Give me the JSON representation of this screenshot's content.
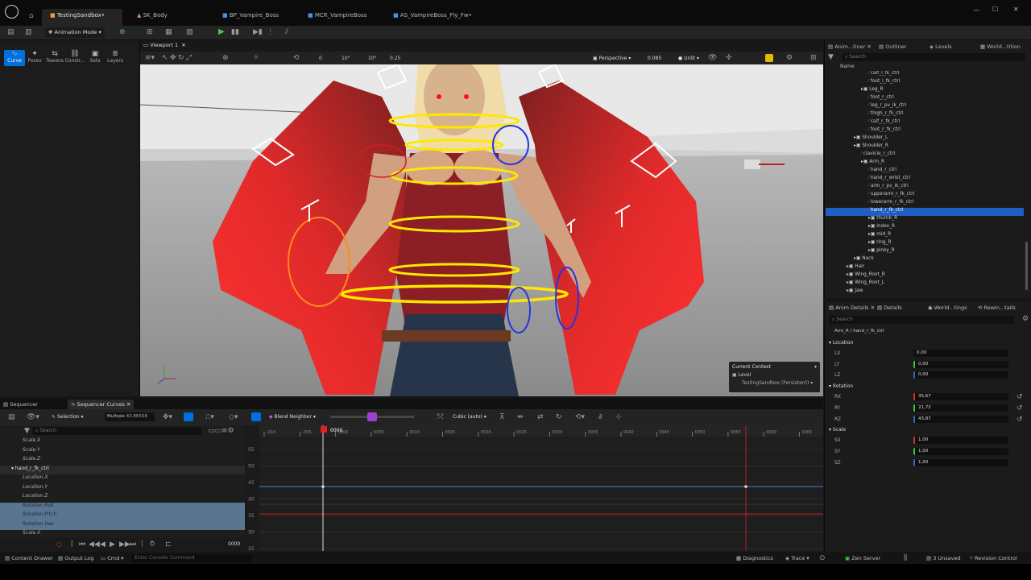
{
  "tabs": [
    "TestingSandbox•",
    "SK_Body",
    "BP_Vampire_Boss",
    "MCR_VampireBoss",
    "AS_VampireBoss_Fly_Fw•"
  ],
  "toolbar": {
    "mode_label": "Animation Mode"
  },
  "modes": [
    "Curve",
    "Poses",
    "Tweens",
    "Constr...",
    "Sets",
    "Layers"
  ],
  "viewport": {
    "tab": "Viewport 1",
    "view": "Perspective",
    "fov": "0.085",
    "unit": "Unlit",
    "snap_rot": "10°",
    "snap_rot2": "10°",
    "scale": "0.25",
    "grid": "0"
  },
  "context": {
    "title": "Current Context",
    "level_label": "Level",
    "level_value": "TestingSandbox (Persistent)"
  },
  "right_tabs": [
    "Anim...tiner",
    "Outliner",
    "Levels",
    "World...tition"
  ],
  "outliner": {
    "search_placeholder": "Search",
    "column": "Name",
    "rows": [
      {
        "l": "calf_l_fk_ctrl",
        "d": 5,
        "k": "c"
      },
      {
        "l": "foot_l_fk_ctrl",
        "d": 5,
        "k": "c"
      },
      {
        "l": "Leg_R",
        "d": 4,
        "k": "g"
      },
      {
        "l": "foot_r_ctrl",
        "d": 5,
        "k": "c"
      },
      {
        "l": "leg_r_pv_ik_ctrl",
        "d": 5,
        "k": "c"
      },
      {
        "l": "thigh_r_fk_ctrl",
        "d": 5,
        "k": "c"
      },
      {
        "l": "calf_r_fk_ctrl",
        "d": 5,
        "k": "c"
      },
      {
        "l": "foot_r_fk_ctrl",
        "d": 5,
        "k": "c"
      },
      {
        "l": "Shoulder_L",
        "d": 3,
        "k": "g"
      },
      {
        "l": "Shoulder_R",
        "d": 3,
        "k": "g"
      },
      {
        "l": "clavicle_r_ctrl",
        "d": 4,
        "k": "c"
      },
      {
        "l": "Arm_R",
        "d": 4,
        "k": "g"
      },
      {
        "l": "hand_r_ctrl",
        "d": 5,
        "k": "c"
      },
      {
        "l": "hand_r_wrist_ctrl",
        "d": 5,
        "k": "c"
      },
      {
        "l": "arm_r_pv_ik_ctrl",
        "d": 5,
        "k": "c"
      },
      {
        "l": "upperarm_r_fk_ctrl",
        "d": 5,
        "k": "c"
      },
      {
        "l": "lowerarm_r_fk_ctrl",
        "d": 5,
        "k": "c"
      },
      {
        "l": "hand_r_fk_ctrl",
        "d": 5,
        "k": "c",
        "sel": true
      },
      {
        "l": "thumb_R",
        "d": 5,
        "k": "g"
      },
      {
        "l": "index_R",
        "d": 5,
        "k": "g"
      },
      {
        "l": "mid_R",
        "d": 5,
        "k": "g"
      },
      {
        "l": "ring_R",
        "d": 5,
        "k": "g"
      },
      {
        "l": "pinky_R",
        "d": 5,
        "k": "g"
      },
      {
        "l": "Neck",
        "d": 3,
        "k": "g"
      },
      {
        "l": "Hair",
        "d": 2,
        "k": "g"
      },
      {
        "l": "Wing_Root_R",
        "d": 2,
        "k": "g"
      },
      {
        "l": "Wing_Root_L",
        "d": 2,
        "k": "g"
      },
      {
        "l": "Jaw",
        "d": 2,
        "k": "g"
      }
    ]
  },
  "details_tabs": [
    "Anim Details",
    "Details",
    "World...tings",
    "Rewin...tails"
  ],
  "details": {
    "search_placeholder": "Search",
    "path": "Arm_R / hand_r_fk_ctrl",
    "location": {
      "title": "Location",
      "LX": "0,00",
      "LY": "0,00",
      "LZ": "0,00"
    },
    "rotation": {
      "title": "Rotation",
      "RX": "35,67",
      "RY": "21,72",
      "RZ": "43,87"
    },
    "scale": {
      "title": "Scale",
      "SX": "1,00",
      "SY": "1,00",
      "SZ": "1,00"
    }
  },
  "sequencer": {
    "tab1": "Sequencer",
    "tab2": "Sequencer Curves",
    "selection": "Selection",
    "multiple": "Multiple",
    "value": "43.86558",
    "blend": "Blend Neighbor",
    "interp": "Cubic (auto)",
    "search_placeholder": "Search",
    "frame": "0000",
    "tracks": [
      "Scale.X",
      "Scale.Y",
      "Scale.Z",
      "hand_r_fk_ctrl",
      "Location.X",
      "Location.Y",
      "Location.Z",
      "Rotation.Roll",
      "Rotation.Pitch",
      "Rotation.Yaw",
      "Scale.X"
    ],
    "y_ticks": [
      "55",
      "50",
      "45",
      "40",
      "35",
      "30",
      "25"
    ],
    "x_ticks": [
      "-010",
      "-005",
      "0000",
      "0005",
      "0010",
      "0015",
      "0020",
      "0025",
      "0030",
      "0035",
      "0040",
      "0045",
      "0050",
      "0055",
      "0060",
      "0065"
    ]
  },
  "status": {
    "content_drawer": "Content Drawer",
    "output_log": "Output Log",
    "cmd": "Cmd",
    "console": "Enter Console Command",
    "diagnostics": "Diagnostics",
    "trace": "Trace",
    "zen": "Zen Server",
    "unsaved": "3 Unsaved",
    "revision": "Revision Control"
  },
  "colors": {
    "accent": "#0070e0",
    "selected_row": "#1f5fc4"
  }
}
